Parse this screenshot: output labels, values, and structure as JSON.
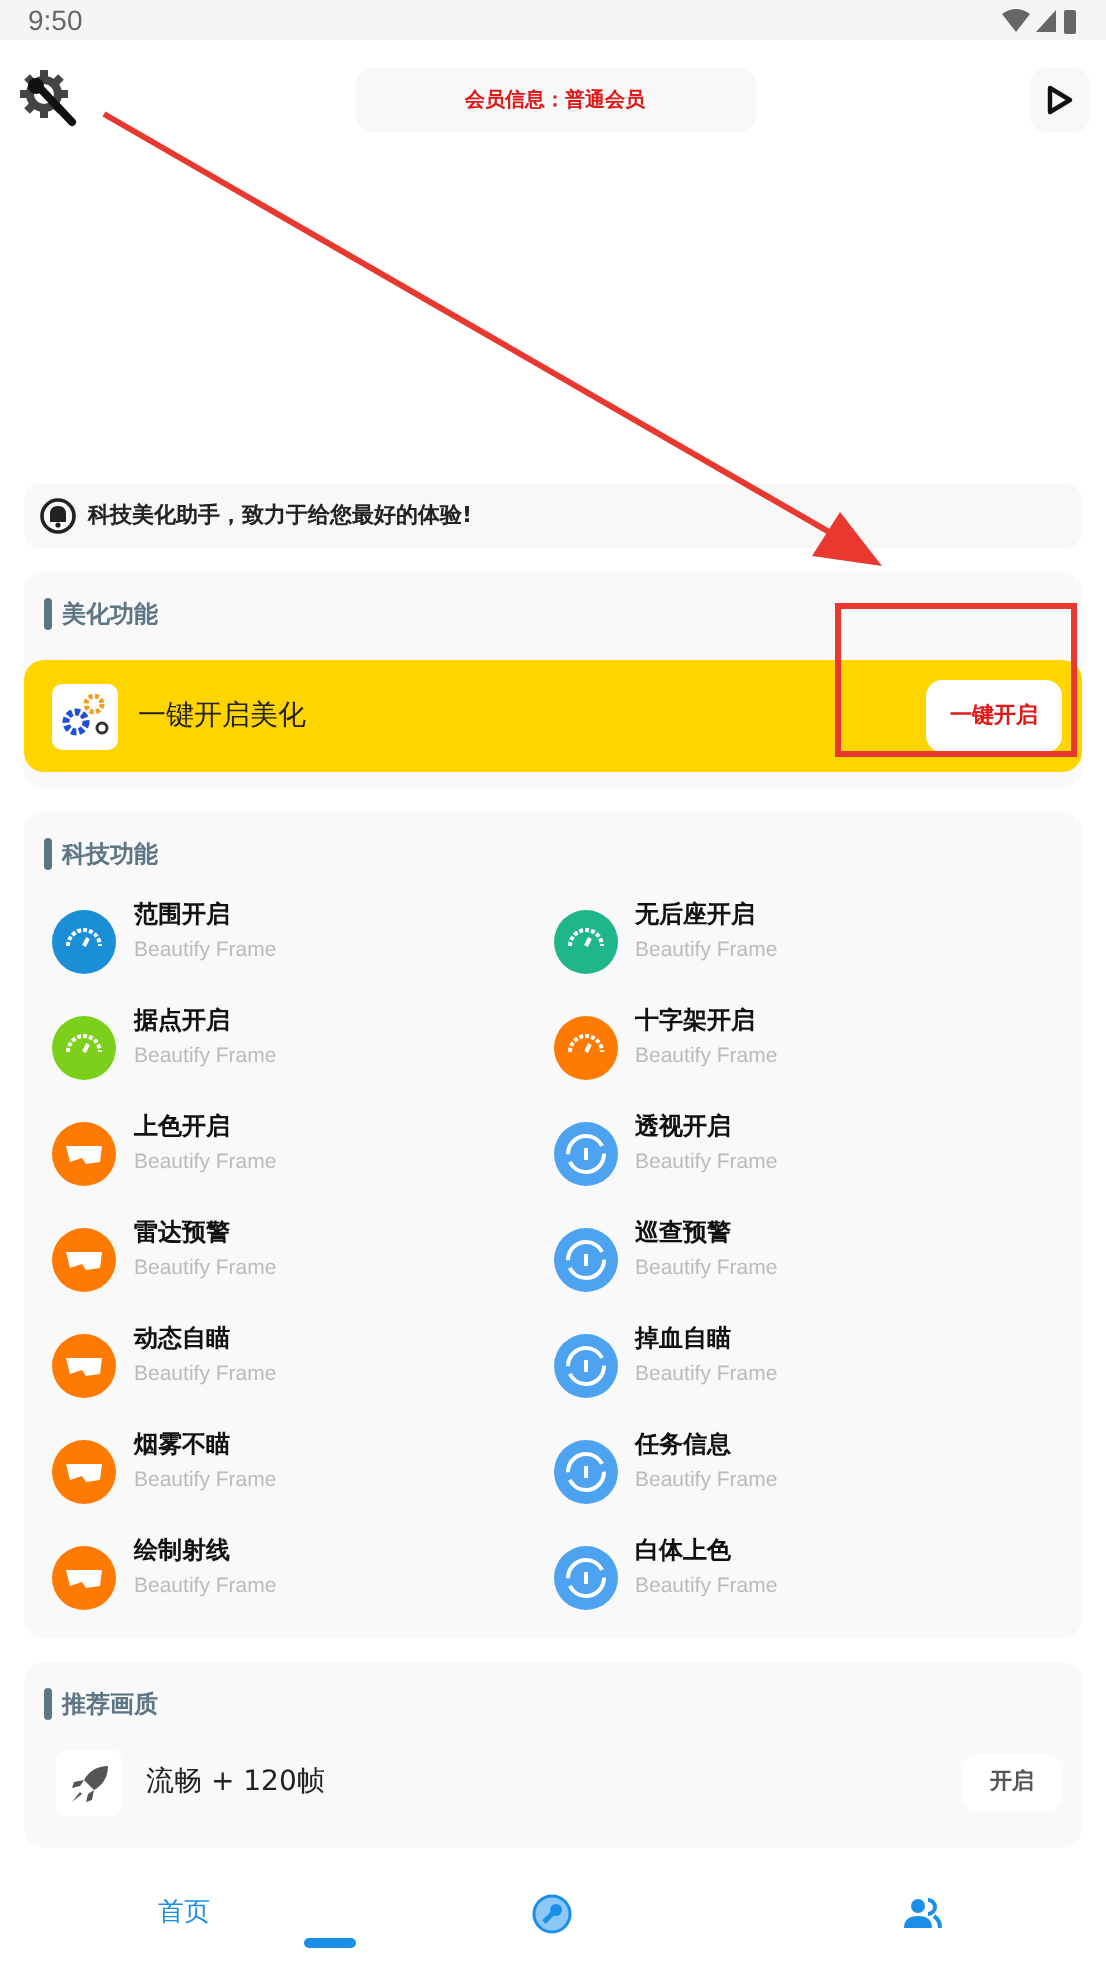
{
  "status_bar": {
    "time": "9:50"
  },
  "header": {
    "member_info": "会员信息：普通会员"
  },
  "notice": "科技美化助手，致力于给您最好的体验!",
  "beautify": {
    "title": "美化功能",
    "item": "一键开启美化",
    "button": "一键开启"
  },
  "tech": {
    "title": "科技功能",
    "items": [
      {
        "label": "范围开启",
        "subtitle": "Beautify Frame",
        "kind": "gauge",
        "color": "#1a8fd8"
      },
      {
        "label": "无后座开启",
        "subtitle": "Beautify Frame",
        "kind": "gauge",
        "color": "#1fb68a"
      },
      {
        "label": "据点开启",
        "subtitle": "Beautify Frame",
        "kind": "gauge",
        "color": "#7ccf1a"
      },
      {
        "label": "十字架开启",
        "subtitle": "Beautify Frame",
        "kind": "gauge",
        "color": "#ff7a00"
      },
      {
        "label": "上色开启",
        "subtitle": "Beautify Frame",
        "kind": "mask",
        "color": "#ff7a00"
      },
      {
        "label": "透视开启",
        "subtitle": "Beautify Frame",
        "kind": "dial",
        "color": "#4ea3f0"
      },
      {
        "label": "雷达预警",
        "subtitle": "Beautify Frame",
        "kind": "mask",
        "color": "#ff7a00"
      },
      {
        "label": "巡查预警",
        "subtitle": "Beautify Frame",
        "kind": "dial",
        "color": "#4ea3f0"
      },
      {
        "label": "动态自瞄",
        "subtitle": "Beautify Frame",
        "kind": "mask",
        "color": "#ff7a00"
      },
      {
        "label": "掉血自瞄",
        "subtitle": "Beautify Frame",
        "kind": "dial",
        "color": "#4ea3f0"
      },
      {
        "label": "烟雾不瞄",
        "subtitle": "Beautify Frame",
        "kind": "mask",
        "color": "#ff7a00"
      },
      {
        "label": "任务信息",
        "subtitle": "Beautify Frame",
        "kind": "dial",
        "color": "#4ea3f0"
      },
      {
        "label": "绘制射线",
        "subtitle": "Beautify Frame",
        "kind": "mask",
        "color": "#ff7a00"
      },
      {
        "label": "白体上色",
        "subtitle": "Beautify Frame",
        "kind": "dial",
        "color": "#4ea3f0"
      }
    ]
  },
  "recommend": {
    "title": "推荐画质",
    "items": [
      {
        "label": "流畅 + 120帧",
        "button": "开启"
      }
    ]
  },
  "bottom_nav": [
    {
      "kind": "text",
      "label": "首页",
      "selected": true
    },
    {
      "kind": "tools",
      "selected": false
    },
    {
      "kind": "people",
      "selected": false
    }
  ]
}
